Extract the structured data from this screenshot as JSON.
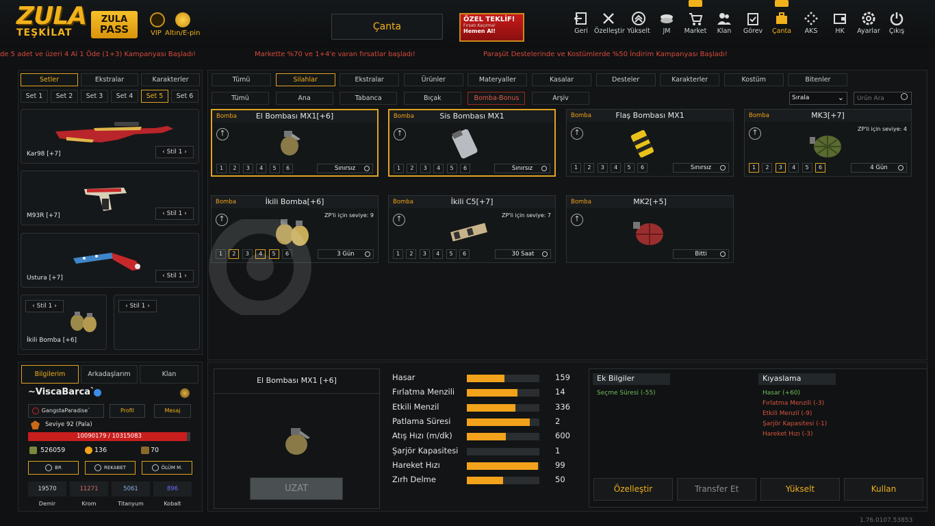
{
  "header": {
    "logo_top": "ZULA",
    "logo_bottom": "TEŞKİLAT",
    "pass_line1": "ZULA",
    "pass_line2": "PASS",
    "vip_label": "VIP",
    "gold_label": "Altın/E-pin",
    "bag_title": "Çanta",
    "offer": {
      "title": "ÖZEL TEKLİF!",
      "subtitle": "Fırsatı Kaçırma!",
      "cta": "Hemen Al!"
    },
    "nav": [
      {
        "label": "Geri",
        "icon": "exit-icon"
      },
      {
        "label": "Özelleştir",
        "icon": "tools-icon"
      },
      {
        "label": "Yükselt",
        "icon": "rank-up-icon"
      },
      {
        "label": "JM",
        "icon": "coins-icon"
      },
      {
        "label": "Market",
        "icon": "cart-icon"
      },
      {
        "label": "Klan",
        "icon": "people-icon"
      },
      {
        "label": "Görev",
        "icon": "clipboard-icon"
      },
      {
        "label": "Çanta",
        "icon": "bag-icon"
      },
      {
        "label": "AKS",
        "icon": "dots-icon"
      },
      {
        "label": "HK",
        "icon": "wallet-icon"
      },
      {
        "label": "Ayarlar",
        "icon": "gear-icon"
      },
      {
        "label": "Çıkış",
        "icon": "power-icon"
      }
    ]
  },
  "ticker": [
    "de 5 adet ve üzeri 4 Al 1 Öde (1+3) Kampanyası Başladı!",
    "Markette %70 ve 1+4'e varan fırsatlar başladı!",
    "Paraşüt Destelerinde ve Kostümlerde %50 İndirim Kampanyası Başladı!"
  ],
  "left": {
    "tabs": [
      "Setler",
      "Ekstralar",
      "Karakterler"
    ],
    "sets": [
      "Set 1",
      "Set 2",
      "Set 3",
      "Set 4",
      "Set 5",
      "Set 6"
    ],
    "slots": [
      {
        "name": "Kar98 [+7]",
        "style": "Stil 1"
      },
      {
        "name": "M93R [+7]",
        "style": "Stil 1"
      },
      {
        "name": "Ustura [+7]",
        "style": "Stil 1"
      },
      {
        "name": "İkili Bomba [+6]",
        "style": "Stil 1"
      },
      {
        "name": "",
        "style": "Stil 1"
      }
    ]
  },
  "profile": {
    "tabs": [
      "Bilgilerim",
      "Arkadaşlarım",
      "Klan"
    ],
    "username": "~ViscaBarca`",
    "clan": "GangstaParadise`",
    "profile_btn": "Profil",
    "message_btn": "Mesaj",
    "level": "Seviye 92 (Pala)",
    "xp": "10090179 / 10315083",
    "xp_ratio": 0.978,
    "zp": "526059",
    "gold": "136",
    "other": "70",
    "modes": [
      "BR",
      "REKABET",
      "ÖLÜM M."
    ],
    "resources": [
      {
        "value": "19570",
        "label": "Demir",
        "color": "#d8d8d8"
      },
      {
        "value": "11271",
        "label": "Krom",
        "color": "#d86a6a"
      },
      {
        "value": "5061",
        "label": "Titanyum",
        "color": "#8ab0e0"
      },
      {
        "value": "896",
        "label": "Kobalt",
        "color": "#6a70ff"
      }
    ]
  },
  "filters": {
    "main": [
      "Tümü",
      "Silahlar",
      "Ekstralar",
      "Ürünler",
      "Materyaller",
      "Kasalar",
      "Desteler",
      "Karakterler",
      "Kostüm",
      "Bitenler"
    ],
    "sub": [
      "Tümü",
      "Ana",
      "Tabanca",
      "Bıçak",
      "Bomba-Bonus",
      "Arşiv"
    ],
    "sort_label": "Sırala",
    "search_placeholder": "Ürün Ara"
  },
  "items": [
    {
      "category": "Bomba",
      "name": "El Bombası MX1[+6]",
      "req": "",
      "duration": "Sınırsız"
    },
    {
      "category": "Bomba",
      "name": "Sis Bombası MX1",
      "req": "",
      "duration": "Sınırsız"
    },
    {
      "category": "Bomba",
      "name": "Flaş Bombası MX1",
      "req": "",
      "duration": "Sınırsız"
    },
    {
      "category": "Bomba",
      "name": "MK3[+7]",
      "req": "ZP'li için seviye: 4",
      "duration": "4 Gün"
    },
    {
      "category": "Bomba",
      "name": "İkili Bomba[+6]",
      "req": "ZP'li için seviye: 9",
      "duration": "3 Gün"
    },
    {
      "category": "Bomba",
      "name": "İkili C5[+7]",
      "req": "ZP'li için seviye: 7",
      "duration": "30 Saat"
    },
    {
      "category": "Bomba",
      "name": "MK2[+5]",
      "req": "",
      "duration": "Bitti"
    }
  ],
  "levels": [
    "1",
    "2",
    "3",
    "4",
    "5",
    "6"
  ],
  "detail": {
    "title": "El Bombası MX1 [+6]",
    "extend_btn": "UZAT",
    "stats": [
      {
        "label": "Hasar",
        "value": "159",
        "ratio": 0.52
      },
      {
        "label": "Fırlatma Menzili",
        "value": "14",
        "ratio": 0.7
      },
      {
        "label": "Etkili Menzil",
        "value": "336",
        "ratio": 0.67
      },
      {
        "label": "Patlama Süresi",
        "value": "2",
        "ratio": 0.87
      },
      {
        "label": "Atış Hızı (m/dk)",
        "value": "600",
        "ratio": 0.54
      },
      {
        "label": "Şarjör Kapasitesi",
        "value": "1",
        "ratio": 0
      },
      {
        "label": "Hareket Hızı",
        "value": "99",
        "ratio": 0.98
      },
      {
        "label": "Zırh Delme",
        "value": "50",
        "ratio": 0.5
      }
    ]
  },
  "extra": {
    "title": "Ek Bilgiler",
    "items": [
      "Seçme Süresi (-55)"
    ],
    "compare_title": "Kıyaslama",
    "compare": [
      {
        "text": "Hasar (+60)",
        "color": "#6fbf5a"
      },
      {
        "text": "Fırlatma Menzili (-3)",
        "color": "#d9553f"
      },
      {
        "text": "Etkili Menzil (-9)",
        "color": "#d9553f"
      },
      {
        "text": "Şarjör Kapasitesi (-1)",
        "color": "#d9553f"
      },
      {
        "text": "Hareket Hızı (-3)",
        "color": "#d9553f"
      }
    ],
    "buttons": [
      "Özelleştir",
      "Transfer Et",
      "Yükselt",
      "Kullan"
    ]
  },
  "version": "1.76.0107.53853",
  "colors": {
    "accent": "#f2b21b",
    "red": "#d9553f",
    "green": "#6fbf5a"
  }
}
